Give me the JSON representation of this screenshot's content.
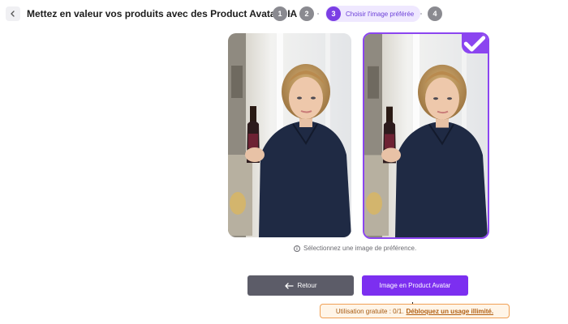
{
  "header": {
    "title": "Mettez en valeur vos produits avec des Product Avatars IA",
    "steps": [
      {
        "number": "1"
      },
      {
        "number": "2"
      },
      {
        "number": "3",
        "label": "Choisir l'image préférée",
        "active": true
      },
      {
        "number": "4"
      }
    ]
  },
  "gallery": {
    "options": [
      {
        "selected": false
      },
      {
        "selected": true
      }
    ],
    "hint": "Sélectionnez une image de préférence."
  },
  "actions": {
    "back_label": "Retour",
    "primary_label": "Image en Product Avatar"
  },
  "usage": {
    "text": "Utilisation gratuite : 0/1.",
    "link": "Débloquez un usage illimité."
  },
  "colors": {
    "accent": "#7c2ff0",
    "secondary_button": "#5c5c68",
    "warning_border": "#f0a055"
  },
  "icons": {
    "back": "chevron-left-icon",
    "selected": "check-icon",
    "info": "info-icon",
    "return": "arrow-left-icon"
  }
}
